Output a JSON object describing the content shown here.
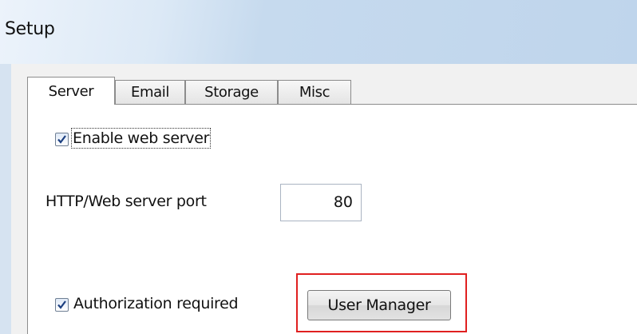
{
  "window": {
    "title": "Setup"
  },
  "tabs": [
    {
      "label": "Server",
      "active": true
    },
    {
      "label": "Email",
      "active": false
    },
    {
      "label": "Storage",
      "active": false
    },
    {
      "label": "Misc",
      "active": false
    }
  ],
  "server": {
    "enable_web_server": {
      "label": "Enable web server",
      "checked": true
    },
    "http_port": {
      "label": "HTTP/Web server port",
      "value": "80"
    },
    "authorization_required": {
      "label": "Authorization required",
      "checked": true
    },
    "user_manager_button": {
      "label": "User Manager"
    }
  },
  "colors": {
    "highlight": "#e02020",
    "checkmark": "#1c3f80"
  }
}
